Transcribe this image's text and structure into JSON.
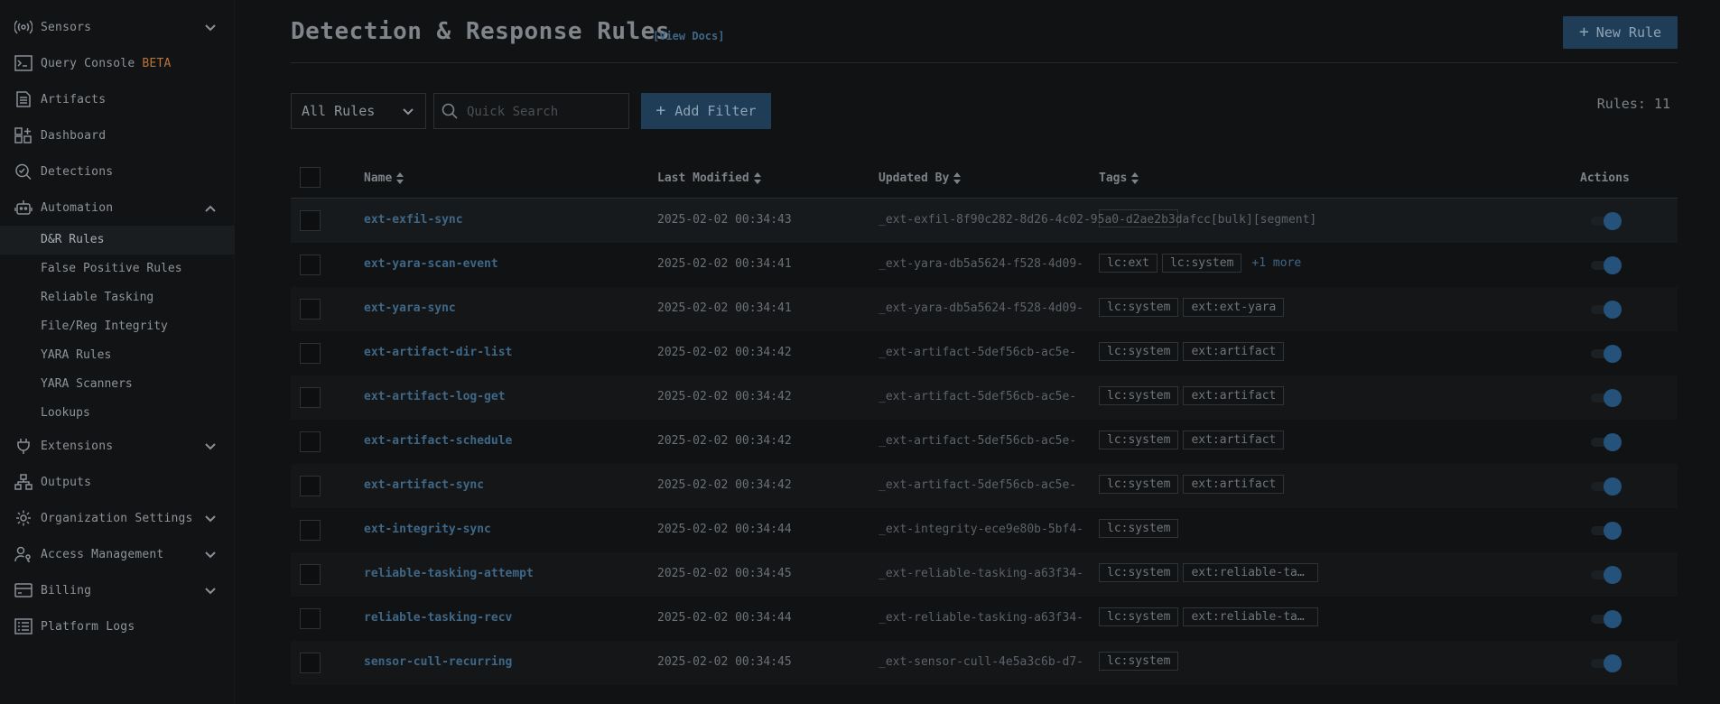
{
  "sidebar": {
    "items": [
      {
        "label": "Sensors",
        "icon": "broadcast-icon"
      },
      {
        "label": "Query Console",
        "badge": "BETA",
        "icon": "terminal-icon"
      },
      {
        "label": "Artifacts",
        "icon": "document-icon"
      },
      {
        "label": "Dashboard",
        "icon": "dashboard-icon"
      },
      {
        "label": "Detections",
        "icon": "search-detections-icon"
      },
      {
        "label": "Automation",
        "icon": "robot-icon"
      },
      {
        "label": "Extensions",
        "icon": "plug-icon"
      },
      {
        "label": "Outputs",
        "icon": "hierarchy-icon"
      },
      {
        "label": "Organization Settings",
        "icon": "gear-icon"
      },
      {
        "label": "Access Management",
        "icon": "user-key-icon"
      },
      {
        "label": "Billing",
        "icon": "credit-card-icon"
      },
      {
        "label": "Platform Logs",
        "icon": "logs-icon"
      }
    ],
    "automation_sub": [
      "D&R Rules",
      "False Positive Rules",
      "Reliable Tasking",
      "File/Reg Integrity",
      "YARA Rules",
      "YARA Scanners",
      "Lookups"
    ]
  },
  "header": {
    "title": "Detection & Response Rules",
    "docs_link": "[View Docs]",
    "new_rule_label": "New Rule"
  },
  "filters": {
    "select_value": "All Rules",
    "search_placeholder": "Quick Search",
    "add_filter_label": "Add Filter",
    "rules_count": "Rules: 11"
  },
  "table": {
    "columns": {
      "name": "Name",
      "last_modified": "Last Modified",
      "updated_by": "Updated By",
      "tags": "Tags",
      "actions": "Actions"
    },
    "rows": [
      {
        "name": "ext-exfil-sync",
        "modified": "2025-02-02 00:34:43",
        "updated_by": "_ext-exfil-8f90c282-8d26-4c02-95a0-d2ae2b3dafcc[bulk][segment]",
        "tags": [],
        "enabled": true
      },
      {
        "name": "ext-yara-scan-event",
        "modified": "2025-02-02 00:34:41",
        "updated_by": "_ext-yara-db5a5624-f528-4d09-",
        "tags": [
          "lc:ext",
          "lc:system"
        ],
        "more": "+1 more",
        "enabled": true
      },
      {
        "name": "ext-yara-sync",
        "modified": "2025-02-02 00:34:41",
        "updated_by": "_ext-yara-db5a5624-f528-4d09-",
        "tags": [
          "lc:system",
          "ext:ext-yara"
        ],
        "enabled": true
      },
      {
        "name": "ext-artifact-dir-list",
        "modified": "2025-02-02 00:34:42",
        "updated_by": "_ext-artifact-5def56cb-ac5e-",
        "tags": [
          "lc:system",
          "ext:artifact"
        ],
        "enabled": true
      },
      {
        "name": "ext-artifact-log-get",
        "modified": "2025-02-02 00:34:42",
        "updated_by": "_ext-artifact-5def56cb-ac5e-",
        "tags": [
          "lc:system",
          "ext:artifact"
        ],
        "enabled": true
      },
      {
        "name": "ext-artifact-schedule",
        "modified": "2025-02-02 00:34:42",
        "updated_by": "_ext-artifact-5def56cb-ac5e-",
        "tags": [
          "lc:system",
          "ext:artifact"
        ],
        "enabled": true
      },
      {
        "name": "ext-artifact-sync",
        "modified": "2025-02-02 00:34:42",
        "updated_by": "_ext-artifact-5def56cb-ac5e-",
        "tags": [
          "lc:system",
          "ext:artifact"
        ],
        "enabled": true
      },
      {
        "name": "ext-integrity-sync",
        "modified": "2025-02-02 00:34:44",
        "updated_by": "_ext-integrity-ece9e80b-5bf4-",
        "tags": [
          "lc:system"
        ],
        "enabled": true
      },
      {
        "name": "reliable-tasking-attempt",
        "modified": "2025-02-02 00:34:45",
        "updated_by": "_ext-reliable-tasking-a63f34-",
        "tags": [
          "lc:system",
          "ext:reliable-tas…"
        ],
        "enabled": true
      },
      {
        "name": "reliable-tasking-recv",
        "modified": "2025-02-02 00:34:44",
        "updated_by": "_ext-reliable-tasking-a63f34-",
        "tags": [
          "lc:system",
          "ext:reliable-tas…"
        ],
        "enabled": true
      },
      {
        "name": "sensor-cull-recurring",
        "modified": "2025-02-02 00:34:45",
        "updated_by": "_ext-sensor-cull-4e5a3c6b-d7-",
        "tags": [
          "lc:system"
        ],
        "enabled": true
      }
    ]
  },
  "colors": {
    "background": "#101213",
    "accent": "#1f3d57",
    "link": "#3f6787",
    "toggle_on": "#24527a",
    "beta": "#b9743c"
  }
}
